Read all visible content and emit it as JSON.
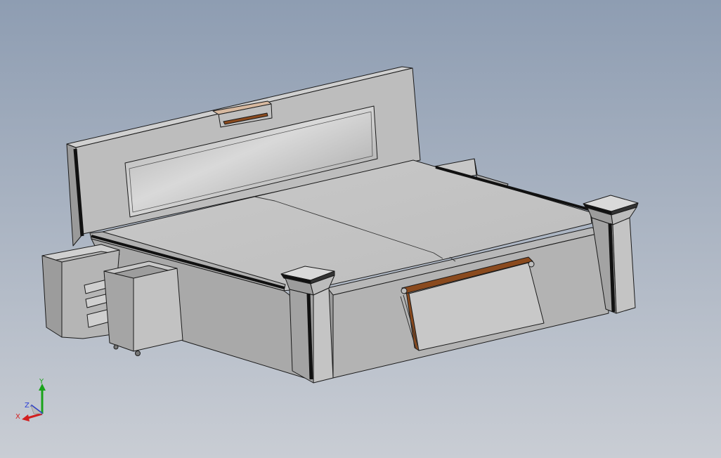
{
  "viewport": {
    "background_top": "#8e9db2",
    "background_bottom": "#c9cdd4",
    "model": {
      "surface": "#bfbfbf",
      "surface_light": "#d2d2d2",
      "surface_dark": "#8f8f8f",
      "edge": "#1a1a1a",
      "wood": "#8a4a1e",
      "wood_light": "#d7b9a0"
    }
  },
  "triad": {
    "x_label": "X",
    "y_label": "Y",
    "z_label": "Z",
    "x_color": "#d21f1f",
    "y_color": "#1aa31a",
    "z_color": "#2a3ed6"
  }
}
